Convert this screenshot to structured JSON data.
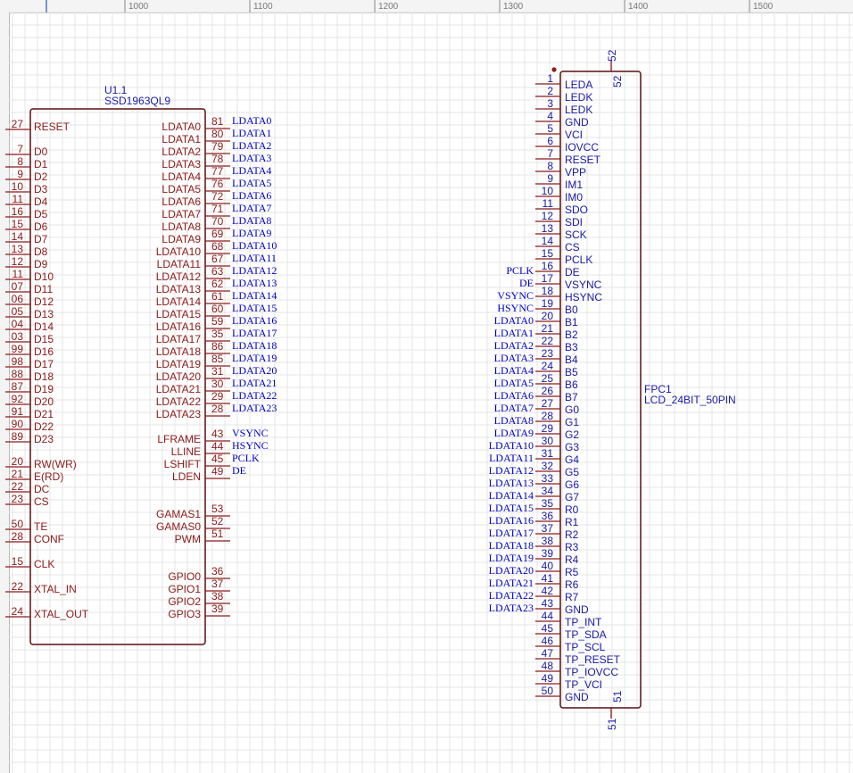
{
  "ruler": {
    "labels": [
      "1000",
      "1100",
      "1200",
      "1300",
      "1400",
      "1500"
    ]
  },
  "colors": {
    "body": "#8b1a1a",
    "pin_name": "#8b1a1a",
    "pin_number": "#8b1a1a",
    "ref": "#1a1aa6",
    "net": "#0000c8",
    "grid": "#e4e4e4",
    "ruler_text": "#777777"
  },
  "u1": {
    "ref": "U1.1",
    "value": "SSD1963QL9",
    "left_pins": [
      {
        "num": "27",
        "name": "RESET"
      },
      {
        "num": "7",
        "name": "D0"
      },
      {
        "num": "8",
        "name": "D1"
      },
      {
        "num": "9",
        "name": "D2"
      },
      {
        "num": "10",
        "name": "D3"
      },
      {
        "num": "11",
        "name": "D4"
      },
      {
        "num": "16",
        "name": "D5"
      },
      {
        "num": "15",
        "name": "D6"
      },
      {
        "num": "14",
        "name": "D7"
      },
      {
        "num": "13",
        "name": "D8"
      },
      {
        "num": "12",
        "name": "D9"
      },
      {
        "num": "11",
        "name": "D10"
      },
      {
        "num": "07",
        "name": "D11"
      },
      {
        "num": "06",
        "name": "D12"
      },
      {
        "num": "05",
        "name": "D13"
      },
      {
        "num": "04",
        "name": "D14"
      },
      {
        "num": "03",
        "name": "D15"
      },
      {
        "num": "99",
        "name": "D16"
      },
      {
        "num": "98",
        "name": "D17"
      },
      {
        "num": "88",
        "name": "D18"
      },
      {
        "num": "87",
        "name": "D19"
      },
      {
        "num": "92",
        "name": "D20"
      },
      {
        "num": "91",
        "name": "D21"
      },
      {
        "num": "90",
        "name": "D22"
      },
      {
        "num": "89",
        "name": "D23"
      },
      {
        "num": "20",
        "name": "RW(WR)"
      },
      {
        "num": "21",
        "name": "E(RD)"
      },
      {
        "num": "22",
        "name": "DC"
      },
      {
        "num": "23",
        "name": "CS"
      },
      {
        "num": "50",
        "name": "TE"
      },
      {
        "num": "28",
        "name": "CONF"
      },
      {
        "num": "15",
        "name": "CLK"
      },
      {
        "num": "22",
        "name": "XTAL_IN"
      },
      {
        "num": "24",
        "name": "XTAL_OUT"
      }
    ],
    "right_pins": [
      {
        "num": "81",
        "name": "LDATA0",
        "net": "LDATA0"
      },
      {
        "num": "80",
        "name": "LDATA1",
        "net": "LDATA1"
      },
      {
        "num": "79",
        "name": "LDATA2",
        "net": "LDATA2"
      },
      {
        "num": "78",
        "name": "LDATA3",
        "net": "LDATA3"
      },
      {
        "num": "77",
        "name": "LDATA4",
        "net": "LDATA4"
      },
      {
        "num": "76",
        "name": "LDATA5",
        "net": "LDATA5"
      },
      {
        "num": "72",
        "name": "LDATA6",
        "net": "LDATA6"
      },
      {
        "num": "71",
        "name": "LDATA7",
        "net": "LDATA7"
      },
      {
        "num": "70",
        "name": "LDATA8",
        "net": "LDATA8"
      },
      {
        "num": "69",
        "name": "LDATA9",
        "net": "LDATA9"
      },
      {
        "num": "68",
        "name": "LDATA10",
        "net": "LDATA10"
      },
      {
        "num": "67",
        "name": "LDATA11",
        "net": "LDATA11"
      },
      {
        "num": "63",
        "name": "LDATA12",
        "net": "LDATA12"
      },
      {
        "num": "62",
        "name": "LDATA13",
        "net": "LDATA13"
      },
      {
        "num": "61",
        "name": "LDATA14",
        "net": "LDATA14"
      },
      {
        "num": "60",
        "name": "LDATA15",
        "net": "LDATA15"
      },
      {
        "num": "59",
        "name": "LDATA16",
        "net": "LDATA16"
      },
      {
        "num": "35",
        "name": "LDATA17",
        "net": "LDATA17"
      },
      {
        "num": "86",
        "name": "LDATA18",
        "net": "LDATA18"
      },
      {
        "num": "85",
        "name": "LDATA19",
        "net": "LDATA19"
      },
      {
        "num": "31",
        "name": "LDATA20",
        "net": "LDATA20"
      },
      {
        "num": "30",
        "name": "LDATA21",
        "net": "LDATA21"
      },
      {
        "num": "29",
        "name": "LDATA22",
        "net": "LDATA22"
      },
      {
        "num": "28",
        "name": "LDATA23",
        "net": "LDATA23"
      },
      {
        "num": "43",
        "name": "LFRAME",
        "net": "VSYNC"
      },
      {
        "num": "44",
        "name": "LLINE",
        "net": "HSYNC"
      },
      {
        "num": "45",
        "name": "LSHIFT",
        "net": "PCLK"
      },
      {
        "num": "49",
        "name": "LDEN",
        "net": "DE"
      },
      {
        "num": "53",
        "name": "GAMAS1",
        "net": ""
      },
      {
        "num": "52",
        "name": "GAMAS0",
        "net": ""
      },
      {
        "num": "51",
        "name": "PWM",
        "net": ""
      },
      {
        "num": "36",
        "name": "GPIO0",
        "net": ""
      },
      {
        "num": "37",
        "name": "GPIO1",
        "net": ""
      },
      {
        "num": "38",
        "name": "GPIO2",
        "net": ""
      },
      {
        "num": "39",
        "name": "GPIO3",
        "net": ""
      }
    ]
  },
  "fpc": {
    "ref": "FPC1",
    "value": "LCD_24BIT_50PIN",
    "top_pin": "52",
    "bottom_pin": "51",
    "pins": [
      {
        "num": "1",
        "name": "LEDA",
        "net": ""
      },
      {
        "num": "2",
        "name": "LEDK",
        "net": ""
      },
      {
        "num": "3",
        "name": "LEDK",
        "net": ""
      },
      {
        "num": "4",
        "name": "GND",
        "net": ""
      },
      {
        "num": "5",
        "name": "VCI",
        "net": ""
      },
      {
        "num": "6",
        "name": "IOVCC",
        "net": ""
      },
      {
        "num": "7",
        "name": "RESET",
        "net": ""
      },
      {
        "num": "8",
        "name": "VPP",
        "net": ""
      },
      {
        "num": "9",
        "name": "IM1",
        "net": ""
      },
      {
        "num": "10",
        "name": "IM0",
        "net": ""
      },
      {
        "num": "11",
        "name": "SDO",
        "net": ""
      },
      {
        "num": "12",
        "name": "SDI",
        "net": ""
      },
      {
        "num": "13",
        "name": "SCK",
        "net": ""
      },
      {
        "num": "14",
        "name": "CS",
        "net": ""
      },
      {
        "num": "15",
        "name": "PCLK",
        "net": ""
      },
      {
        "num": "16",
        "name": "DE",
        "net": "PCLK"
      },
      {
        "num": "17",
        "name": "VSYNC",
        "net": "DE"
      },
      {
        "num": "18",
        "name": "HSYNC",
        "net": "VSYNC"
      },
      {
        "num": "19",
        "name": "B0",
        "net": "HSYNC"
      },
      {
        "num": "20",
        "name": "B1",
        "net": "LDATA0"
      },
      {
        "num": "21",
        "name": "B2",
        "net": "LDATA1"
      },
      {
        "num": "22",
        "name": "B3",
        "net": "LDATA2"
      },
      {
        "num": "23",
        "name": "B4",
        "net": "LDATA3"
      },
      {
        "num": "24",
        "name": "B5",
        "net": "LDATA4"
      },
      {
        "num": "25",
        "name": "B6",
        "net": "LDATA5"
      },
      {
        "num": "26",
        "name": "B7",
        "net": "LDATA6"
      },
      {
        "num": "27",
        "name": "G0",
        "net": "LDATA7"
      },
      {
        "num": "28",
        "name": "G1",
        "net": "LDATA8"
      },
      {
        "num": "29",
        "name": "G2",
        "net": "LDATA9"
      },
      {
        "num": "30",
        "name": "G3",
        "net": "LDATA10"
      },
      {
        "num": "31",
        "name": "G4",
        "net": "LDATA11"
      },
      {
        "num": "32",
        "name": "G5",
        "net": "LDATA12"
      },
      {
        "num": "33",
        "name": "G6",
        "net": "LDATA13"
      },
      {
        "num": "34",
        "name": "G7",
        "net": "LDATA14"
      },
      {
        "num": "35",
        "name": "R0",
        "net": "LDATA15"
      },
      {
        "num": "36",
        "name": "R1",
        "net": "LDATA16"
      },
      {
        "num": "37",
        "name": "R2",
        "net": "LDATA17"
      },
      {
        "num": "38",
        "name": "R3",
        "net": "LDATA18"
      },
      {
        "num": "39",
        "name": "R4",
        "net": "LDATA19"
      },
      {
        "num": "40",
        "name": "R5",
        "net": "LDATA20"
      },
      {
        "num": "41",
        "name": "R6",
        "net": "LDATA21"
      },
      {
        "num": "42",
        "name": "R7",
        "net": "LDATA22"
      },
      {
        "num": "43",
        "name": "GND",
        "net": "LDATA23"
      },
      {
        "num": "44",
        "name": "TP_INT",
        "net": ""
      },
      {
        "num": "45",
        "name": "TP_SDA",
        "net": ""
      },
      {
        "num": "46",
        "name": "TP_SCL",
        "net": ""
      },
      {
        "num": "47",
        "name": "TP_RESET",
        "net": ""
      },
      {
        "num": "48",
        "name": "TP_IOVCC",
        "net": ""
      },
      {
        "num": "49",
        "name": "TP_VCI",
        "net": ""
      },
      {
        "num": "50",
        "name": "GND",
        "net": ""
      }
    ]
  }
}
